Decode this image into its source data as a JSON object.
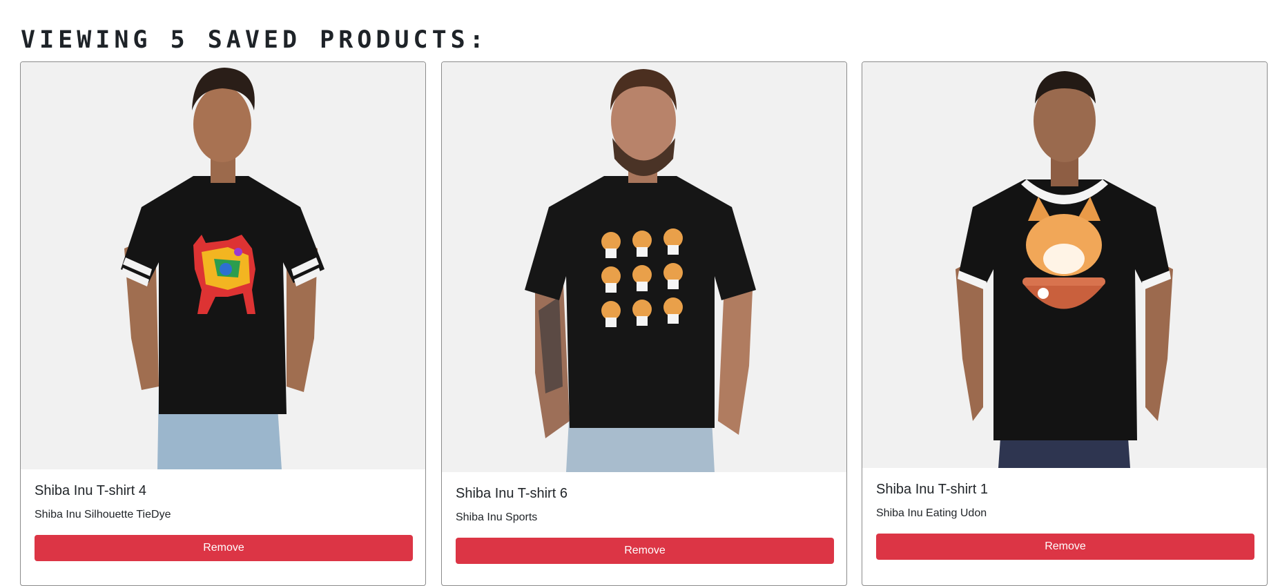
{
  "page": {
    "title": "VIEWING 5 SAVED PRODUCTS:"
  },
  "colors": {
    "remove_button": "#dc3545",
    "image_background": "#f1f1f1",
    "shirt": "#141414"
  },
  "products": [
    {
      "title": "Shiba Inu T-shirt 4",
      "subtitle": "Shiba Inu Silhouette TieDye",
      "remove_label": "Remove",
      "image": "man-wearing-black-tshirt-with-tiedye-shiba-silhouette"
    },
    {
      "title": "Shiba Inu T-shirt 6",
      "subtitle": "Shiba Inu Sports",
      "remove_label": "Remove",
      "image": "man-wearing-black-tshirt-with-shiba-sports-print"
    },
    {
      "title": "Shiba Inu T-shirt 1",
      "subtitle": "Shiba Inu Eating Udon",
      "remove_label": "Remove",
      "image": "man-wearing-black-ringer-tshirt-with-shiba-udon-print"
    }
  ]
}
